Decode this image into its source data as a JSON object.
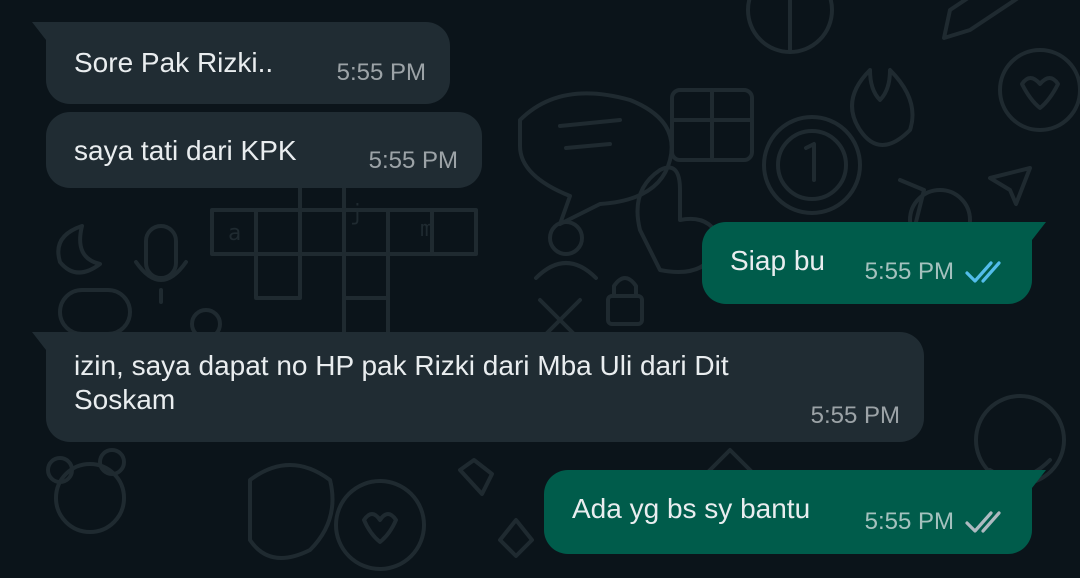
{
  "theme": {
    "background": "#0b141a",
    "incoming_bubble": "#202c33",
    "outgoing_bubble": "#005c4b",
    "text": "#e9edef",
    "read_tick": "#53bdeb",
    "delivered_tick": "#aebac1"
  },
  "messages": [
    {
      "direction": "incoming",
      "text": "Sore Pak Rizki..",
      "time": "5:55 PM"
    },
    {
      "direction": "incoming",
      "text": "saya tati dari KPK",
      "time": "5:55 PM"
    },
    {
      "direction": "outgoing",
      "text": "Siap bu",
      "time": "5:55 PM",
      "status": "read",
      "status_icon": "double-check-icon"
    },
    {
      "direction": "incoming",
      "text": "izin, saya dapat no HP pak Rizki dari Mba Uli dari Dit Soskam",
      "time": "5:55 PM"
    },
    {
      "direction": "outgoing",
      "text": "Ada yg bs sy bantu",
      "time": "5:55 PM",
      "status": "delivered",
      "status_icon": "double-check-icon"
    }
  ]
}
